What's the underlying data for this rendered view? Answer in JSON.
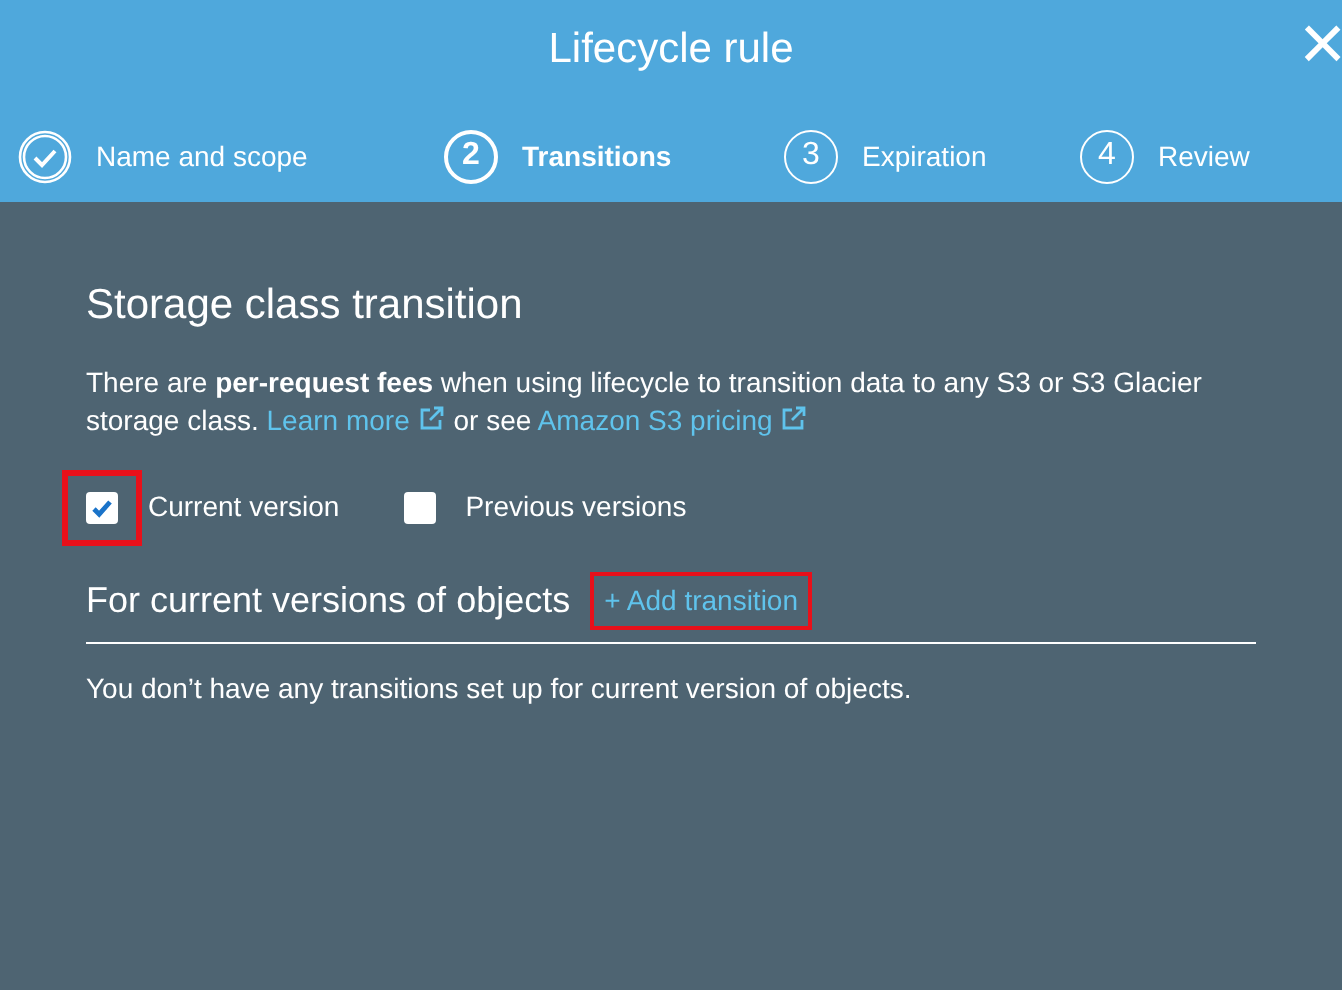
{
  "window": {
    "title": "Lifecycle rule",
    "close": "×"
  },
  "steps": [
    {
      "kind": "done",
      "label": "Name and scope",
      "selected": false
    },
    {
      "kind": "numbered",
      "number": "2",
      "label": "Transitions",
      "selected": true
    },
    {
      "kind": "numbered",
      "number": "3",
      "label": "Expiration",
      "selected": false
    },
    {
      "kind": "numbered",
      "number": "4",
      "label": "Review",
      "selected": false
    }
  ],
  "section": {
    "title": "Storage class transition",
    "description": [
      {
        "kind": "text",
        "text": "There are **per-request fees** when using lifecycle to transition data to any S3 or S3 Glacier storage class."
      },
      {
        "kind": "link",
        "text": "Learn more"
      },
      {
        "kind": "text",
        "text": "or see"
      },
      {
        "kind": "link",
        "text": "Amazon S3 pricing"
      }
    ],
    "versions": [
      {
        "label": "Current version",
        "checked": true,
        "highlighted": true
      },
      {
        "label": "Previous versions",
        "checked": false,
        "highlighted": false
      }
    ]
  },
  "current_versions": {
    "title": "For current versions of objects",
    "add_button": {
      "label": "+ Add transition",
      "highlighted": true
    },
    "empty_message": "You don’t have any transitions set up for current version of objects."
  }
}
